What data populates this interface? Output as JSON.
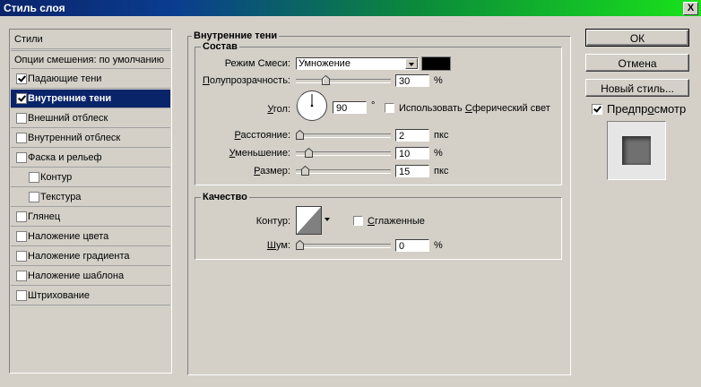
{
  "window": {
    "title": "Стиль слоя",
    "close": "X"
  },
  "sidebar": {
    "items": [
      {
        "label": "Стили",
        "checkbox": false,
        "checked": false,
        "selected": false,
        "sub": false
      },
      {
        "label": "Опции смешения: по умолчанию",
        "checkbox": false,
        "checked": false,
        "selected": false,
        "sub": false
      },
      {
        "label": "Падающие тени",
        "checkbox": true,
        "checked": true,
        "selected": false,
        "sub": false
      },
      {
        "label": "Внутренние тени",
        "checkbox": true,
        "checked": true,
        "selected": true,
        "sub": false
      },
      {
        "label": "Внешний отблеск",
        "checkbox": true,
        "checked": false,
        "selected": false,
        "sub": false
      },
      {
        "label": "Внутренний отблеск",
        "checkbox": true,
        "checked": false,
        "selected": false,
        "sub": false
      },
      {
        "label": "Фаска и рельеф",
        "checkbox": true,
        "checked": false,
        "selected": false,
        "sub": false
      },
      {
        "label": "Контур",
        "checkbox": true,
        "checked": false,
        "selected": false,
        "sub": true
      },
      {
        "label": "Текстура",
        "checkbox": true,
        "checked": false,
        "selected": false,
        "sub": true
      },
      {
        "label": "Глянец",
        "checkbox": true,
        "checked": false,
        "selected": false,
        "sub": false
      },
      {
        "label": "Наложение цвета",
        "checkbox": true,
        "checked": false,
        "selected": false,
        "sub": false
      },
      {
        "label": "Наложение градиента",
        "checkbox": true,
        "checked": false,
        "selected": false,
        "sub": false
      },
      {
        "label": "Наложение шаблона",
        "checkbox": true,
        "checked": false,
        "selected": false,
        "sub": false
      },
      {
        "label": "Штрихование",
        "checkbox": true,
        "checked": false,
        "selected": false,
        "sub": false
      }
    ]
  },
  "panel": {
    "title": "Внутренние тени",
    "structure": {
      "title": "Состав",
      "blend_mode_label": "Режим Смеси:",
      "blend_mode_value": "Умножение",
      "shadow_color": "#000000",
      "opacity_label": "Полупрозрачность:",
      "opacity_value": "30",
      "opacity_unit": "%",
      "opacity_fraction": 0.3,
      "angle_label": "Угол:",
      "angle_value": "90",
      "angle_unit": "°",
      "global_light_label": "Использовать Сферический свет",
      "global_light_checked": false,
      "distance_label": "Расстояние:",
      "distance_value": "2",
      "distance_unit": "пкс",
      "distance_fraction": 0.0,
      "choke_label": "Уменьшение:",
      "choke_value": "10",
      "choke_unit": "%",
      "choke_fraction": 0.1,
      "size_label": "Размер:",
      "size_value": "15",
      "size_unit": "пкс",
      "size_fraction": 0.06
    },
    "quality": {
      "title": "Качество",
      "contour_label": "Контур:",
      "antialiased_label": "Сглаженные",
      "antialiased_checked": false,
      "noise_label": "Шум:",
      "noise_value": "0",
      "noise_unit": "%",
      "noise_fraction": 0.0
    }
  },
  "buttons": {
    "ok": "ОК",
    "cancel": "Отмена",
    "new_style": "Новый стиль..."
  },
  "preview": {
    "label": "Предпросмотр",
    "checked": true
  }
}
